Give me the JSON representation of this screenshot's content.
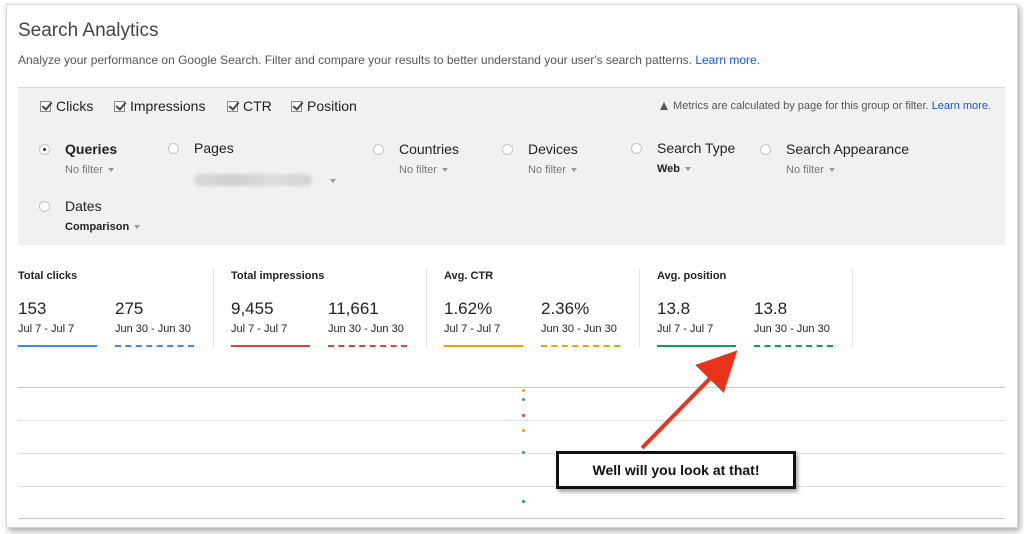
{
  "header": {
    "title": "Search Analytics",
    "subtitle": "Analyze your performance on Google Search. Filter and compare your results to better understand your user's search patterns.",
    "learn_more": "Learn more."
  },
  "metrics": {
    "checkboxes": [
      {
        "label": "Clicks",
        "checked": true
      },
      {
        "label": "Impressions",
        "checked": true
      },
      {
        "label": "CTR",
        "checked": true
      },
      {
        "label": "Position",
        "checked": true
      }
    ],
    "note": "Metrics are calculated by page for this group or filter.",
    "note_link": "Learn more."
  },
  "filters": {
    "queries": {
      "label": "Queries",
      "value": "No filter",
      "selected": true
    },
    "pages": {
      "label": "Pages",
      "value": ""
    },
    "countries": {
      "label": "Countries",
      "value": "No filter"
    },
    "devices": {
      "label": "Devices",
      "value": "No filter"
    },
    "search_type": {
      "label": "Search Type",
      "value": "Web"
    },
    "search_appearance": {
      "label": "Search Appearance",
      "value": "No filter"
    },
    "dates": {
      "label": "Dates",
      "value": "Comparison"
    }
  },
  "stats": [
    {
      "title": "Total clicks",
      "color": "#4285f4",
      "a": {
        "value": "153",
        "range": "Jul 7 - Jul 7"
      },
      "b": {
        "value": "275",
        "range": "Jun 30 - Jun 30"
      }
    },
    {
      "title": "Total impressions",
      "color": "#db4437",
      "a": {
        "value": "9,455",
        "range": "Jul 7 - Jul 7"
      },
      "b": {
        "value": "11,661",
        "range": "Jun 30 - Jun 30"
      }
    },
    {
      "title": "Avg. CTR",
      "color": "#f4a100",
      "a": {
        "value": "1.62%",
        "range": "Jul 7 - Jul 7"
      },
      "b": {
        "value": "2.36%",
        "range": "Jun 30 - Jun 30"
      }
    },
    {
      "title": "Avg. position",
      "color": "#0f9d58",
      "a": {
        "value": "13.8",
        "range": "Jul 7 - Jul 7"
      },
      "b": {
        "value": "13.8",
        "range": "Jun 30 - Jun 30"
      }
    }
  ],
  "callout": {
    "text": "Well will you look at that!",
    "arrow_color": "#e8341c"
  }
}
